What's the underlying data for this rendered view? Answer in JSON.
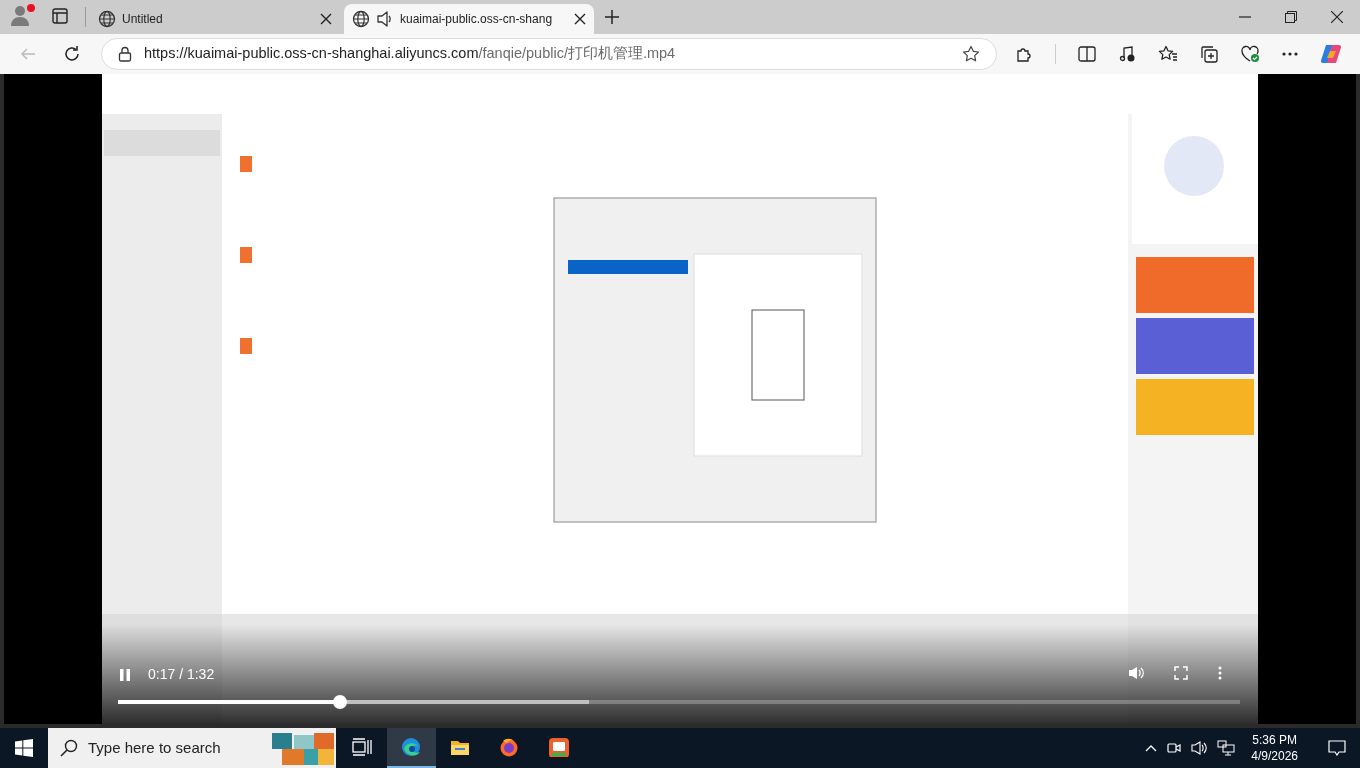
{
  "browser": {
    "tabs": [
      {
        "title": "Untitled",
        "selected": false,
        "audio": false
      },
      {
        "title": "kuaimai-public.oss-cn-shang",
        "selected": true,
        "audio": true
      }
    ],
    "address": {
      "host": "https://kuaimai-public.oss-cn-shanghai.aliyuncs.com",
      "path": "/fanqie/public/打印机管理.mp4"
    }
  },
  "video": {
    "kind": "picture",
    "playing": true,
    "time": "0:17 / 1:32",
    "progress": {
      "level": 0.198
    },
    "buffered": {
      "level": 0.42
    }
  },
  "taskbar": {
    "search": {
      "placeholder": "Type here to search"
    },
    "apps": [
      {
        "kind": "taskview",
        "selected": false
      },
      {
        "kind": "edge",
        "selected": true
      },
      {
        "kind": "folder",
        "selected": false
      },
      {
        "kind": "firefox",
        "selected": false
      },
      {
        "kind": "store",
        "selected": false
      }
    ],
    "clock": {
      "time": "5:36 PM",
      "date": "4/9/2026"
    }
  }
}
